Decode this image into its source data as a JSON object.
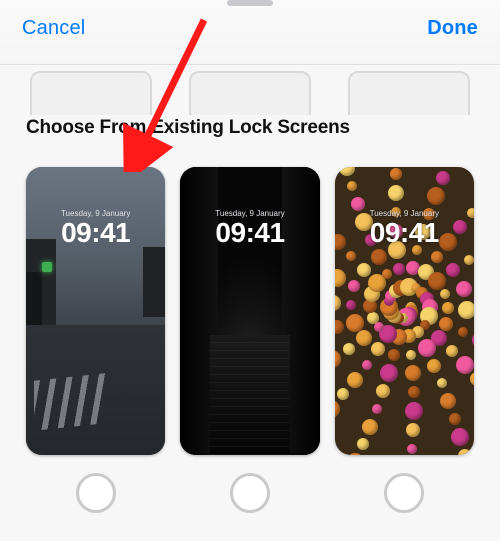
{
  "nav": {
    "cancel": "Cancel",
    "done": "Done"
  },
  "section_title": "Choose From Existing Lock Screens",
  "cards": [
    {
      "date": "Tuesday, 9 January",
      "time": "09:41"
    },
    {
      "date": "Tuesday, 9 January",
      "time": "09:41"
    },
    {
      "date": "Tuesday, 9 January",
      "time": "09:41"
    }
  ],
  "colors": {
    "accent": "#007aff",
    "radio_ring": "#c9c9c9",
    "arrow": "#ff1a1a"
  }
}
